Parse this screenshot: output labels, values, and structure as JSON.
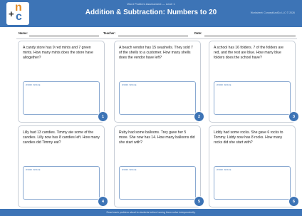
{
  "header": {
    "logo": {
      "plus": "+",
      "n": "n",
      "c": "c"
    },
    "subtitle": "Word Problem Assessment — Level 1",
    "title": "Addition & Subtraction: Numbers to 20",
    "right_text": "Worksheet: ConceptAndGo LLC © 2026"
  },
  "meta": {
    "name_label": "Name:",
    "teacher_label": "Teacher:",
    "date_label": "Date:"
  },
  "work_space_label": "WORK SPACE",
  "problems": [
    {
      "number": "1",
      "text": "A candy store has 9 red mints and 7 green mints. How many mints does the store have altogether?"
    },
    {
      "number": "2",
      "text": "A beach vendor has 15 seashells. They sold 7 of the shells to a customer. How many shells does the vendor have left?"
    },
    {
      "number": "3",
      "text": "A school has 16 folders. 7 of the folders are red, and the rest are blue. How many blue folders does the school have?"
    },
    {
      "number": "4",
      "text": "Lilly had 13 candies. Timmy ate some of the candies. Lilly now has 8 candies left. How many candies did Timmy eat?"
    },
    {
      "number": "5",
      "text": "Ruby had some balloons. Trey gave her 5 more. She now has 14. How many balloons did she start with?"
    },
    {
      "number": "6",
      "text": "Liddy had some rocks. She gave 6 rocks to Tommy. Liddy now has 8 rocks. How many rocks did she start with?"
    }
  ],
  "footer": "Read each problem aloud to students before having them solve independently.",
  "colors": {
    "primary": "#3d74b6",
    "accent": "#e38b24"
  }
}
